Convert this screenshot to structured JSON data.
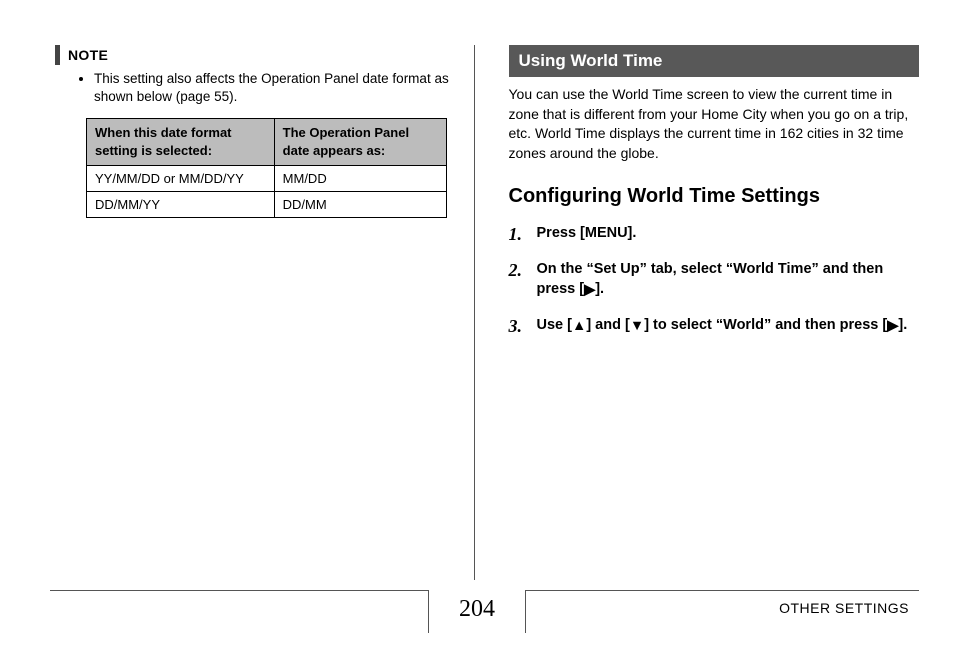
{
  "left": {
    "note_label": "NOTE",
    "note_item": "This setting also affects the Operation Panel date format as shown below (page 55).",
    "table": {
      "header1": "When this date format setting is selected:",
      "header2": "The Operation Panel date appears as:",
      "rows": [
        {
          "c1": "YY/MM/DD or MM/DD/YY",
          "c2": "MM/DD"
        },
        {
          "c1": "DD/MM/YY",
          "c2": "DD/MM"
        }
      ]
    }
  },
  "right": {
    "section_title": "Using World Time",
    "intro": "You can use the World Time screen to view the current time in zone that is different from your Home City when you go on a trip, etc. World Time displays the current time in 162 cities in 32 time zones around the globe.",
    "subheading": "Configuring World Time Settings",
    "steps": {
      "s1": "Press [MENU].",
      "s2a": "On the “Set Up” tab, select “World Time” and then press [",
      "s2b": "].",
      "s3a": "Use [",
      "s3b": "] and [",
      "s3c": "] to select “World” and then press [",
      "s3d": "]."
    }
  },
  "footer": {
    "page_number": "204",
    "section_label": "OTHER SETTINGS"
  }
}
